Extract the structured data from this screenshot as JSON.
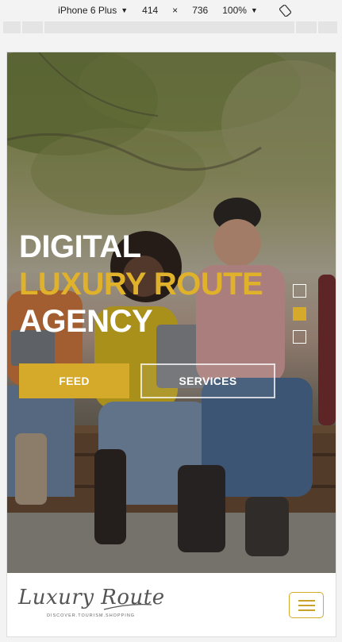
{
  "devtools": {
    "device": "iPhone 6 Plus",
    "width": "414",
    "times": "×",
    "height": "736",
    "zoom": "100%"
  },
  "hero": {
    "line1": "DIGITAL",
    "line2": "LUXURY ROUTE",
    "line3": "AGENCY",
    "feed_label": "FEED",
    "services_label": "SERVICES",
    "slides_total": 3,
    "slide_active": 2
  },
  "navbar": {
    "logo_text": "Luxury Route",
    "logo_tagline": "DISCOVER.TOURISM.SHOPPING"
  },
  "colors": {
    "accent": "#d5a92a",
    "headline_gold": "#e0b12a",
    "white": "#ffffff"
  },
  "icons": {
    "rotate": "rotate-icon",
    "menu": "hamburger-menu-icon"
  }
}
